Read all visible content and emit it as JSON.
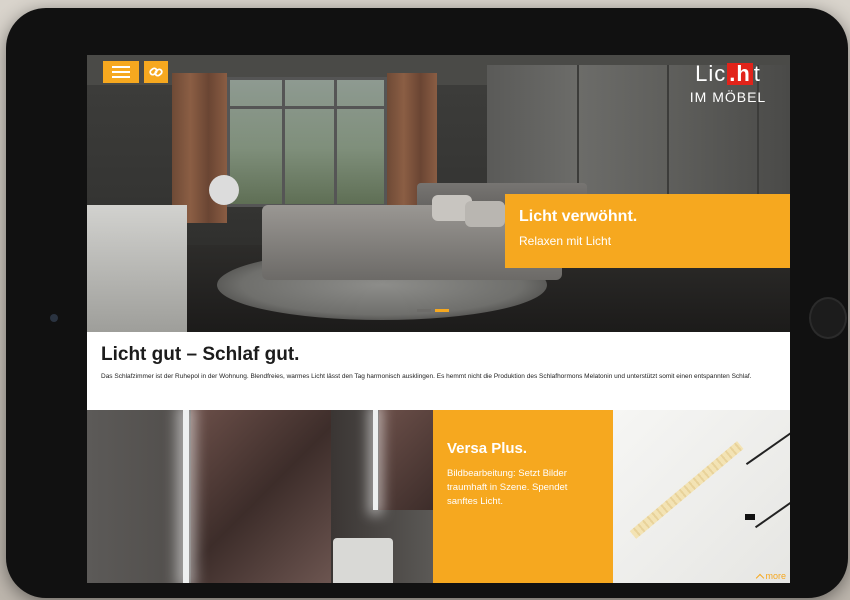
{
  "colors": {
    "accent": "#f6a81f",
    "logo_red": "#e2231a",
    "tablet": "#111111"
  },
  "header": {
    "menu_icon": "hamburger-icon",
    "link_icon": "link-icon",
    "logo": {
      "part1": "Lic",
      "part2": ".h",
      "part3": "t",
      "sub": "IM MÖBEL"
    }
  },
  "hero": {
    "title": "Licht verwöhnt.",
    "subtitle": "Relaxen mit Licht",
    "slides": [
      {
        "active": false
      },
      {
        "active": true
      }
    ]
  },
  "intro": {
    "title": "Licht gut – Schlaf gut.",
    "text": "Das Schlafzimmer ist der Ruhepol in der Wohnung. Blendfreies, warmes Licht lässt den Tag harmonisch ausklingen. Es hemmt nicht die Produktion des Schlafhormons Melatonin und unterstützt somit einen entspannten Schlaf."
  },
  "feature": {
    "title": "Versa Plus.",
    "text": "Bildbearbeitung: Setzt Bilder traumhaft in Szene. Spendet sanftes Licht."
  },
  "more": {
    "label": "more",
    "icon": "chevron-up-icon"
  }
}
